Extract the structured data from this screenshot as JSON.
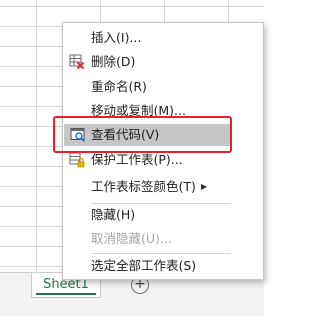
{
  "menu": {
    "items": [
      {
        "label": "插入(I)...",
        "key": "insert",
        "disabled": false
      },
      {
        "label": "删除(D)",
        "key": "delete",
        "disabled": false,
        "icon": "delete-sheet-icon"
      },
      {
        "label": "重命名(R)",
        "key": "rename",
        "disabled": false
      },
      {
        "label": "移动或复制(M)...",
        "key": "move-copy",
        "disabled": false
      },
      {
        "label": "查看代码(V)",
        "key": "view-code",
        "disabled": false,
        "icon": "view-code-icon",
        "highlighted": true
      },
      {
        "label": "保护工作表(P)...",
        "key": "protect-sheet",
        "disabled": false,
        "icon": "protect-sheet-icon"
      },
      {
        "label": "工作表标签颜色(T)",
        "key": "tab-color",
        "disabled": false,
        "submenu": true
      },
      {
        "label": "隐藏(H)",
        "key": "hide",
        "disabled": false
      },
      {
        "label": "取消隐藏(U)...",
        "key": "unhide",
        "disabled": true
      },
      {
        "label": "选定全部工作表(S)",
        "key": "select-all",
        "disabled": false
      }
    ]
  },
  "tabs": {
    "sheet_name": "Sheet1",
    "add_symbol": "+"
  },
  "colors": {
    "accent": "#217346",
    "highlight_box": "#e8202a",
    "hover": "#c6c6c6"
  }
}
